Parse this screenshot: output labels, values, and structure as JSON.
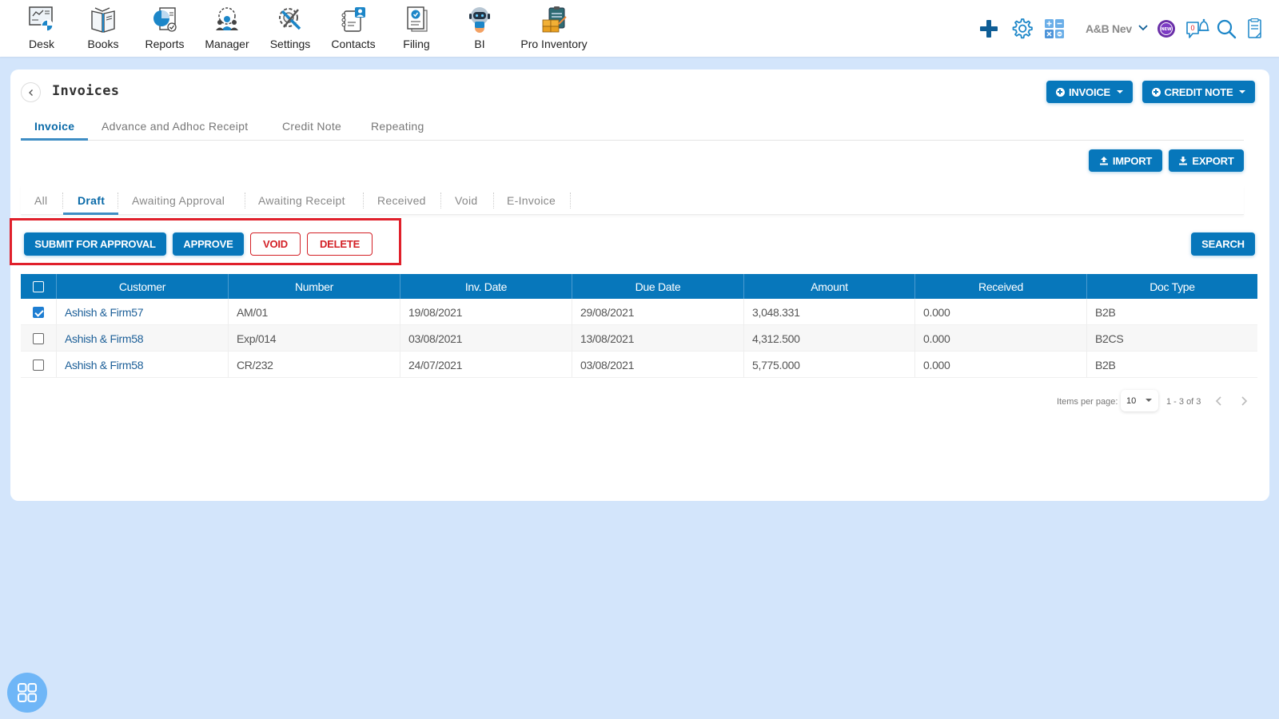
{
  "topnav": {
    "items": [
      {
        "label": "Desk",
        "icon": "desk-icon"
      },
      {
        "label": "Books",
        "icon": "books-icon"
      },
      {
        "label": "Reports",
        "icon": "reports-icon"
      },
      {
        "label": "Manager",
        "icon": "manager-icon"
      },
      {
        "label": "Settings",
        "icon": "settings-tools-icon"
      },
      {
        "label": "Contacts",
        "icon": "contacts-icon"
      },
      {
        "label": "Filing",
        "icon": "filing-icon"
      },
      {
        "label": "BI",
        "icon": "bi-robot-icon"
      },
      {
        "label": "Pro Inventory",
        "icon": "pro-inventory-icon"
      }
    ],
    "right": {
      "org_name": "A&B Nev",
      "new_badge": "NEW",
      "notification_count": "0",
      "icons": [
        "plus-icon",
        "gear-icon",
        "calculator-icon",
        "chevron-down-icon",
        "new-badge-icon",
        "notification-bell-icon",
        "search-icon",
        "document-icon"
      ]
    }
  },
  "page": {
    "title": "Invoices",
    "buttons": {
      "invoice": "INVOICE",
      "credit_note": "CREDIT NOTE",
      "import": "IMPORT",
      "export": "EXPORT",
      "search": "SEARCH"
    },
    "main_tabs": [
      {
        "label": "Invoice",
        "active": true
      },
      {
        "label": "Advance and Adhoc Receipt",
        "active": false
      },
      {
        "label": "Credit Note",
        "active": false
      },
      {
        "label": "Repeating",
        "active": false
      }
    ],
    "status_tabs": [
      {
        "label": "All",
        "active": false
      },
      {
        "label": "Draft",
        "active": true
      },
      {
        "label": "Awaiting Approval",
        "active": false
      },
      {
        "label": "Awaiting Receipt",
        "active": false
      },
      {
        "label": "Received",
        "active": false
      },
      {
        "label": "Void",
        "active": false
      },
      {
        "label": "E-Invoice",
        "active": false
      }
    ],
    "actions": {
      "submit_for_approval": "SUBMIT FOR APPROVAL",
      "approve": "APPROVE",
      "void": "VOID",
      "delete": "DELETE"
    }
  },
  "table": {
    "columns": [
      "Customer",
      "Number",
      "Inv. Date",
      "Due Date",
      "Amount",
      "Received",
      "Doc Type"
    ],
    "rows": [
      {
        "checked": true,
        "customer": "Ashish & Firm57",
        "number": "AM/01",
        "inv_date": "19/08/2021",
        "due_date": "29/08/2021",
        "amount": "3,048.331",
        "received": "0.000",
        "doc_type": "B2B"
      },
      {
        "checked": false,
        "customer": "Ashish & Firm58",
        "number": "Exp/014",
        "inv_date": "03/08/2021",
        "due_date": "13/08/2021",
        "amount": "4,312.500",
        "received": "0.000",
        "doc_type": "B2CS"
      },
      {
        "checked": false,
        "customer": "Ashish & Firm58",
        "number": "CR/232",
        "inv_date": "24/07/2021",
        "due_date": "03/08/2021",
        "amount": "5,775.000",
        "received": "0.000",
        "doc_type": "B2B"
      }
    ]
  },
  "pagination": {
    "items_per_page_label": "Items per page:",
    "items_per_page": "10",
    "range": "1 - 3 of 3"
  },
  "colors": {
    "primary": "#0777bb",
    "danger": "#d32026",
    "background": "#d3e5fb",
    "highlight": "#e0202b"
  }
}
